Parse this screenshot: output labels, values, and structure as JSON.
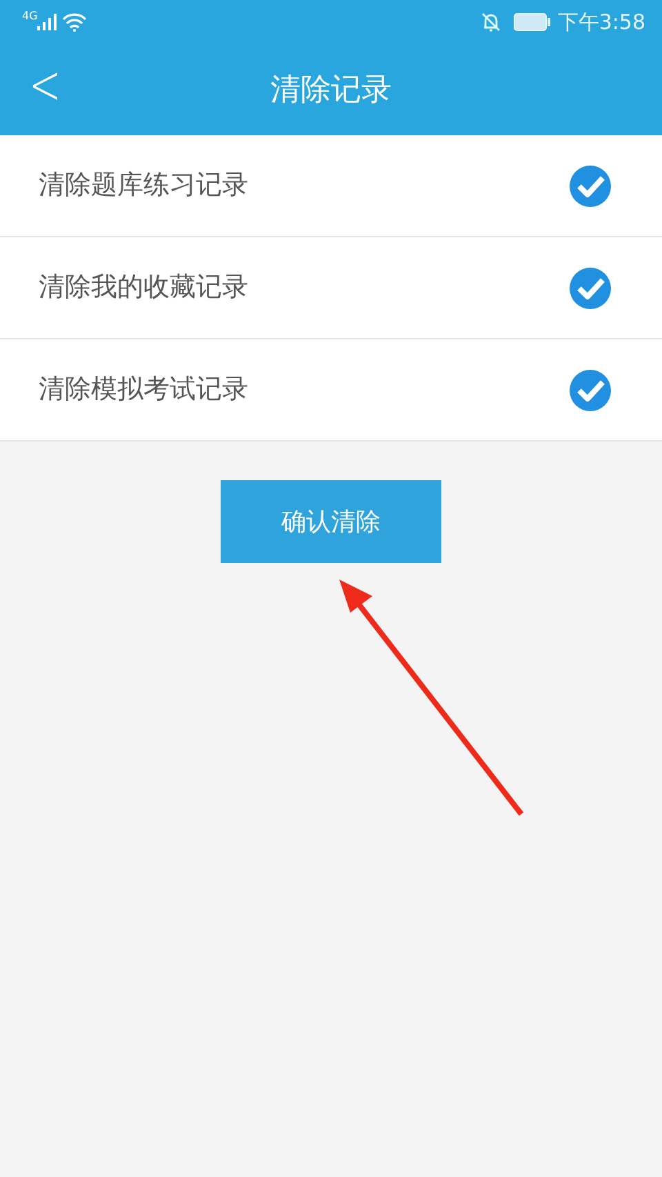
{
  "status_bar": {
    "network": "4G",
    "time": "下午3:58"
  },
  "header": {
    "back": "<",
    "title": "清除记录"
  },
  "options": [
    {
      "label": "清除题库练习记录",
      "checked": true
    },
    {
      "label": "清除我的收藏记录",
      "checked": true
    },
    {
      "label": "清除模拟考试记录",
      "checked": true
    }
  ],
  "confirm_button": "确认清除"
}
